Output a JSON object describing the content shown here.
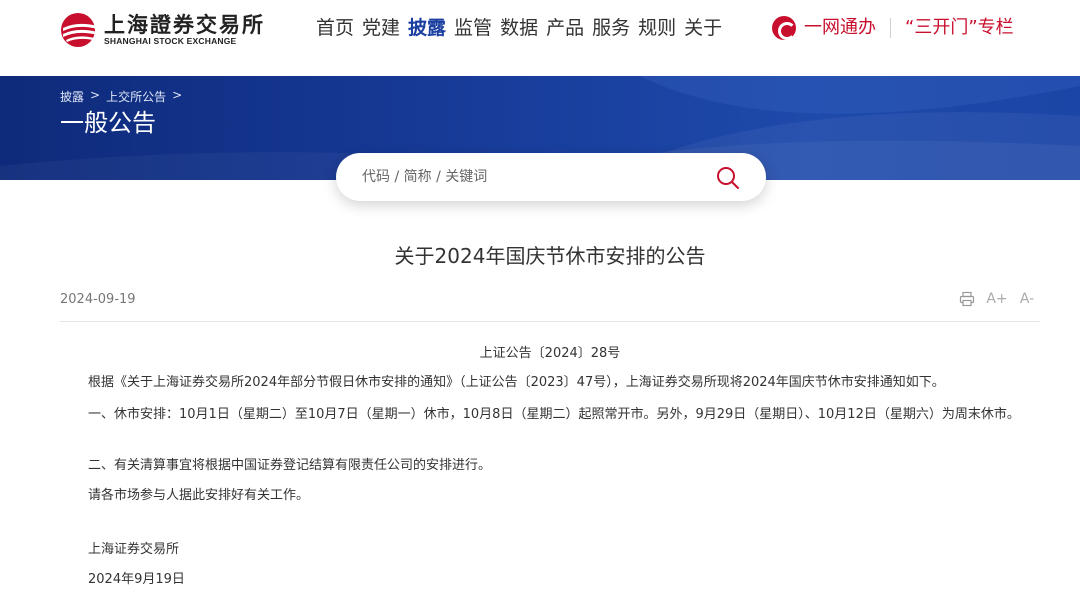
{
  "header": {
    "logo_cn": "上海證券交易所",
    "logo_en": "SHANGHAI STOCK EXCHANGE",
    "nav": [
      "首页",
      "党建",
      "披露",
      "监管",
      "数据",
      "产品",
      "服务",
      "规则",
      "关于"
    ],
    "nav_active": "披露",
    "right_links": [
      "一网通办",
      "“三开门”专栏"
    ]
  },
  "banner": {
    "breadcrumb": [
      "披露",
      ">",
      "上交所公告",
      ">"
    ],
    "title": "一般公告"
  },
  "search": {
    "placeholder": "代码 / 简称 / 关键词"
  },
  "article": {
    "title": "关于2024年国庆节休市安排的公告",
    "date": "2024-09-19",
    "tools": {
      "font_up": "A+",
      "font_down": "A-"
    },
    "doc_no": "上证公告〔2024〕28号",
    "paragraphs": [
      "根据《关于上海证券交易所2024年部分节假日休市安排的通知》（上证公告〔2023〕47号），上海证券交易所现将2024年国庆节休市安排通知如下。",
      "一、休市安排：10月1日（星期二）至10月7日（星期一）休市，10月8日（星期二）起照常开市。另外，9月29日（星期日）、10月12日（星期六）为周末休市。",
      "二、有关清算事宜将根据中国证券登记结算有限责任公司的安排进行。",
      "请各市场参与人据此安排好有关工作。"
    ],
    "signature": "上海证券交易所",
    "sign_date": "2024年9月19日"
  },
  "colors": {
    "brand_red": "#c8102e",
    "nav_active": "#1a3fa0",
    "banner": "#183c9a"
  }
}
